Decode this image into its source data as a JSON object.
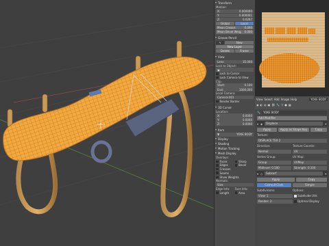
{
  "npanel": {
    "transform_title": "Transform",
    "median_label": "Median:",
    "x_label": "X:",
    "x_value": "0.000000",
    "y_label": "Y:",
    "y_value": "0.000001",
    "z_label": "Z:",
    "z_value": "0.0267",
    "global_label": "Global",
    "local_label": "Local",
    "mean_crease": "Mean Crease:",
    "mean_crease_value": "0.000",
    "mean_bevel": "Mean Bevel Weig:",
    "mean_bevel_value": "0.000",
    "grease_title": "Grease Pencil",
    "new_label": "New",
    "new_layer_label": "New Layer",
    "delete_label": "Delete",
    "frame_label": "Frame",
    "view_title": "View",
    "lens_label": "Lens:",
    "lens_value": "35.000",
    "lock_to_object": "Lock to Object:",
    "lock_to_cursor": "Lock to Cursor",
    "lock_camera": "Lock Camera to View",
    "clip_label": "Clip:",
    "start_label": "Start:",
    "start_value": "0.100",
    "end_label": "End:",
    "end_value": "1000.000",
    "local_camera": "Local Camera:",
    "camera_value": "Camera.001",
    "render_border": "Render Border",
    "cursor_title": "3D Cursor",
    "location_label": "Location:",
    "cx": "0.0000",
    "cy": "0.0000",
    "cz": "0.0000",
    "item_title": "Item",
    "item_name": "YOKE BODY",
    "display_title": "Display",
    "shading_title": "Shading",
    "motion_title": "Motion Tracking",
    "mesh_display": "Mesh Display",
    "overlays": "Overlays:",
    "faces": "Faces",
    "edges": "Edges",
    "creases": "Creases",
    "seams": "Seams",
    "sharp": "Sharp",
    "bevel": "Bevel",
    "show_weights": "Show Weights",
    "normals": "Normals:",
    "size_label": "Size:",
    "edge_info": "Edge Info:",
    "face_info": "Face Info:",
    "length": "Length",
    "area": "Area"
  },
  "props": {
    "header_tabs": [
      "View",
      "Select",
      "Add",
      "Image",
      "Help"
    ],
    "header_name": "YOKE BODY",
    "add_modifier": "Add Modifier",
    "displace_name": "Displace",
    "apply": "Apply",
    "apply_as_shape": "Apply as Shape Key",
    "copy": "Copy",
    "texture_label": "Texture:",
    "texture_value": "DISPLACE TEX 2",
    "direction_label": "Direction:",
    "direction_value": "Normal",
    "texture_coords_label": "Texture Coordin:",
    "texture_coords_value": "UV",
    "vertex_group_label": "Vertex Group:",
    "vertex_group_value": "Group",
    "uv_map_label": "UV Map:",
    "uv_map_value": "UVMap",
    "midlevel_label": "Midlevel:",
    "midlevel_value": "0.500",
    "strength_label": "Strength:",
    "strength_value": "0.100",
    "subsurf_name": "Subsurf",
    "catmull": "Catmull-Clark",
    "simple": "Simple",
    "subdivisions": "Subdivisions:",
    "options": "Options:",
    "view_label": "View:",
    "view_value": "1",
    "render_label": "Render:",
    "render_value": "2",
    "subdivide_uvs": "Subdivide UVs",
    "optimal_display": "Optimal Display"
  },
  "colors": {
    "mesh": "#f2a134",
    "wire": "#8a5a1a",
    "metal": "#5b647f",
    "accent": "#5680c2"
  }
}
